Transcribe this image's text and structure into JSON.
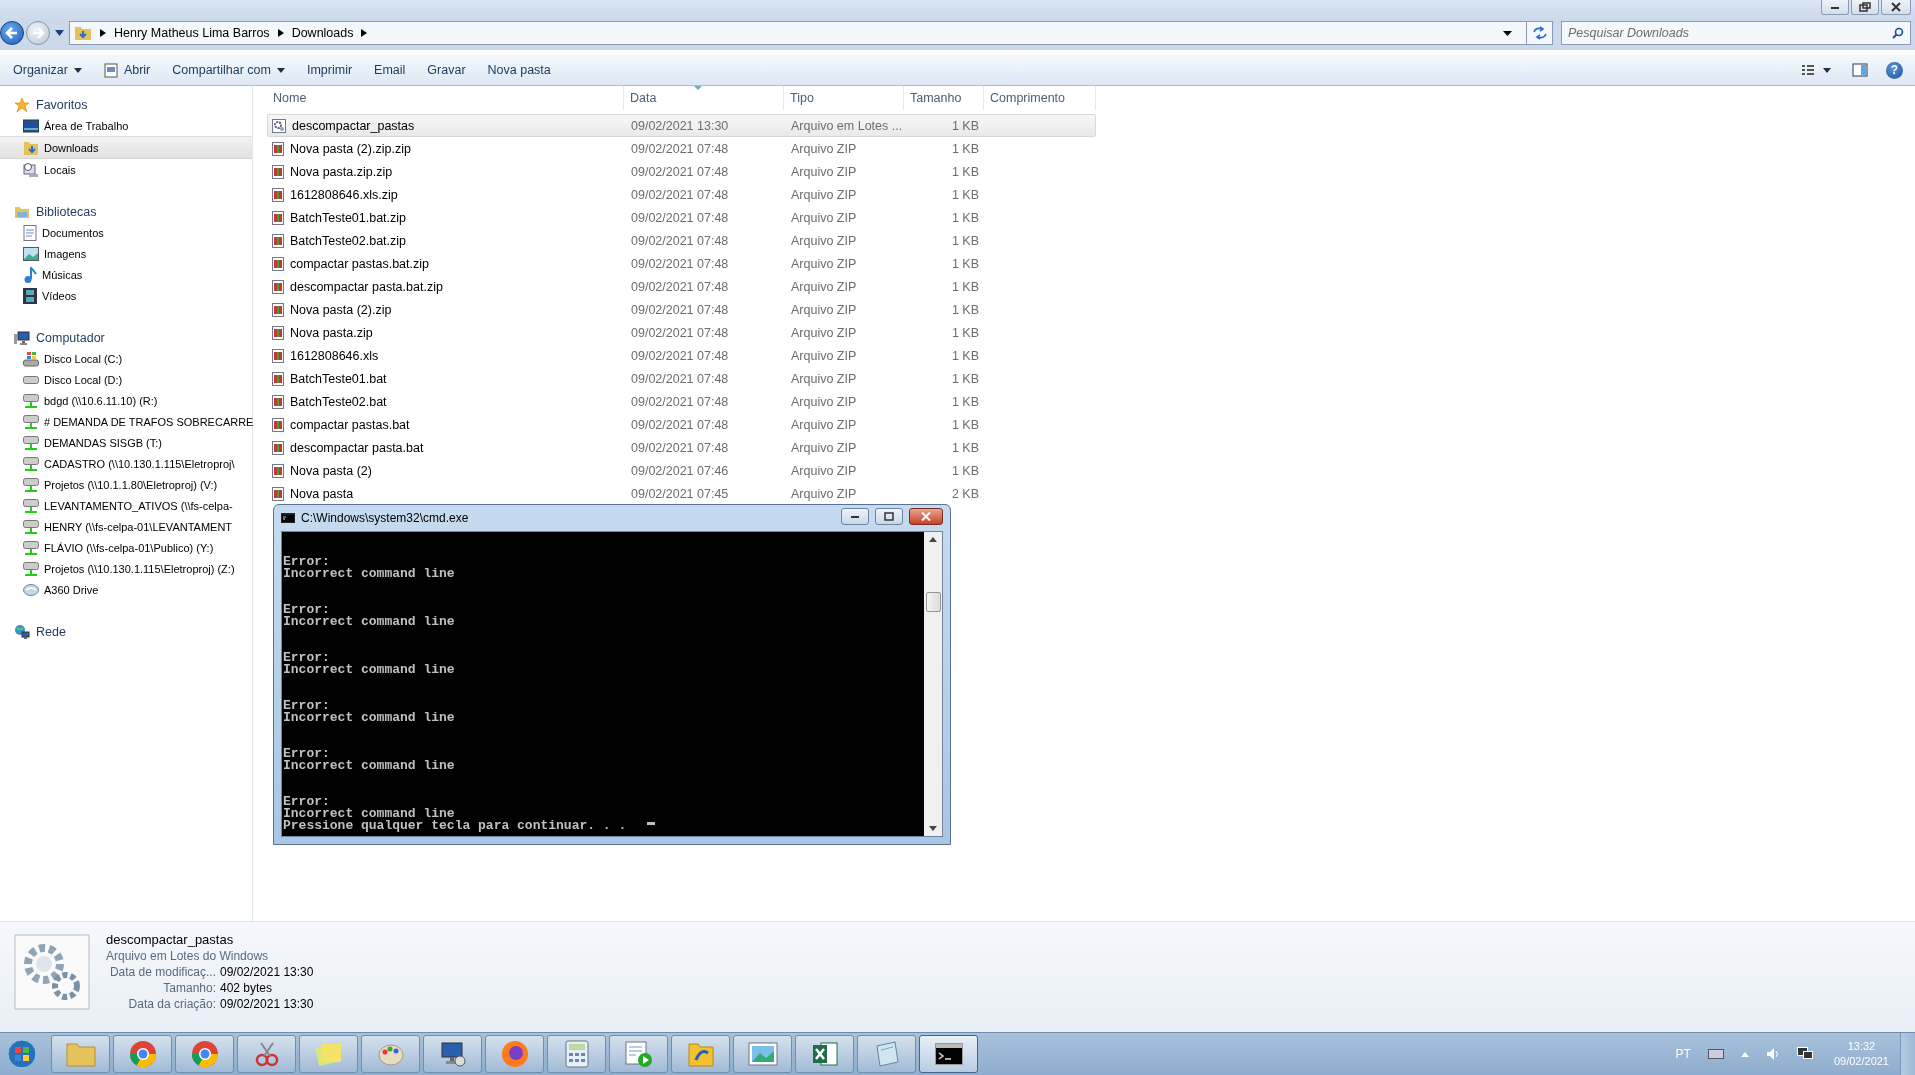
{
  "address": {
    "crumbs": [
      "Henry Matheus Lima Barros",
      "Downloads"
    ]
  },
  "search": {
    "placeholder": "Pesquisar Downloads"
  },
  "toolbar": [
    {
      "label": "Organizar",
      "kind": "menu"
    },
    {
      "label": "Abrir",
      "kind": "icon"
    },
    {
      "label": "Compartilhar com",
      "kind": "menu"
    },
    {
      "label": "Imprimir",
      "kind": "plain"
    },
    {
      "label": "Email",
      "kind": "plain"
    },
    {
      "label": "Gravar",
      "kind": "plain"
    },
    {
      "label": "Nova pasta",
      "kind": "plain"
    }
  ],
  "sidebar": {
    "groups": [
      {
        "label": "Favoritos",
        "kind": "star",
        "children": [
          {
            "label": "Área de Trabalho",
            "kind": "desktop",
            "selected": false
          },
          {
            "label": "Downloads",
            "kind": "downloads",
            "selected": true
          },
          {
            "label": "Locais",
            "kind": "recent",
            "selected": false
          }
        ]
      },
      {
        "label": "Bibliotecas",
        "kind": "library",
        "children": [
          {
            "label": "Documentos",
            "kind": "docs",
            "selected": false
          },
          {
            "label": "Imagens",
            "kind": "images",
            "selected": false
          },
          {
            "label": "Músicas",
            "kind": "music",
            "selected": false
          },
          {
            "label": "Vídeos",
            "kind": "video",
            "selected": false
          }
        ]
      },
      {
        "label": "Computador",
        "kind": "computer",
        "children": [
          {
            "label": "Disco Local (C:)",
            "kind": "windrive",
            "selected": false
          },
          {
            "label": "Disco Local (D:)",
            "kind": "drive",
            "selected": false
          },
          {
            "label": "bdgd (\\\\10.6.11.10) (R:)",
            "kind": "netdrive",
            "selected": false
          },
          {
            "label": "# DEMANDA DE TRAFOS SOBRECARRE",
            "kind": "netdrive",
            "selected": false
          },
          {
            "label": "DEMANDAS SISGB (T:)",
            "kind": "netdrive",
            "selected": false
          },
          {
            "label": "CADASTRO (\\\\10.130.1.115\\Eletroproj\\",
            "kind": "netdrive",
            "selected": false
          },
          {
            "label": "Projetos (\\\\10.1.1.80\\Eletroproj) (V:)",
            "kind": "netdrive",
            "selected": false
          },
          {
            "label": "LEVANTAMENTO_ATIVOS (\\\\fs-celpa-",
            "kind": "netdrive",
            "selected": false
          },
          {
            "label": "HENRY (\\\\fs-celpa-01\\LEVANTAMENT",
            "kind": "netdrive",
            "selected": false
          },
          {
            "label": "FLÁVIO (\\\\fs-celpa-01\\Publico) (Y:)",
            "kind": "netdrive",
            "selected": false
          },
          {
            "label": "Projetos (\\\\10.130.1.115\\Eletroproj) (Z:)",
            "kind": "netdrive",
            "selected": false
          },
          {
            "label": "A360 Drive",
            "kind": "cloud",
            "selected": false
          }
        ]
      },
      {
        "label": "Rede",
        "kind": "network"
      }
    ]
  },
  "help": {
    "label": "?"
  },
  "columns": [
    {
      "label": "Nome",
      "sorted": false
    },
    {
      "label": "Data",
      "sorted": true
    },
    {
      "label": "Tipo",
      "sorted": false
    },
    {
      "label": "Tamanho",
      "sorted": false
    },
    {
      "label": "Comprimento",
      "sorted": false
    }
  ],
  "files": [
    {
      "name": "descompactar_pastas",
      "date": "09/02/2021 13:30",
      "type": "Arquivo em Lotes ...",
      "size": "1 KB",
      "kind": "batch",
      "selected": true
    },
    {
      "name": "Nova pasta (2).zip.zip",
      "date": "09/02/2021 07:48",
      "type": "Arquivo ZIP",
      "size": "1 KB",
      "kind": "zip",
      "selected": false
    },
    {
      "name": "Nova pasta.zip.zip",
      "date": "09/02/2021 07:48",
      "type": "Arquivo ZIP",
      "size": "1 KB",
      "kind": "zip",
      "selected": false
    },
    {
      "name": "1612808646.xls.zip",
      "date": "09/02/2021 07:48",
      "type": "Arquivo ZIP",
      "size": "1 KB",
      "kind": "zip",
      "selected": false
    },
    {
      "name": "BatchTeste01.bat.zip",
      "date": "09/02/2021 07:48",
      "type": "Arquivo ZIP",
      "size": "1 KB",
      "kind": "zip",
      "selected": false
    },
    {
      "name": "BatchTeste02.bat.zip",
      "date": "09/02/2021 07:48",
      "type": "Arquivo ZIP",
      "size": "1 KB",
      "kind": "zip",
      "selected": false
    },
    {
      "name": "compactar pastas.bat.zip",
      "date": "09/02/2021 07:48",
      "type": "Arquivo ZIP",
      "size": "1 KB",
      "kind": "zip",
      "selected": false
    },
    {
      "name": "descompactar pasta.bat.zip",
      "date": "09/02/2021 07:48",
      "type": "Arquivo ZIP",
      "size": "1 KB",
      "kind": "zip",
      "selected": false
    },
    {
      "name": "Nova pasta (2).zip",
      "date": "09/02/2021 07:48",
      "type": "Arquivo ZIP",
      "size": "1 KB",
      "kind": "zip",
      "selected": false
    },
    {
      "name": "Nova pasta.zip",
      "date": "09/02/2021 07:48",
      "type": "Arquivo ZIP",
      "size": "1 KB",
      "kind": "zip",
      "selected": false
    },
    {
      "name": "1612808646.xls",
      "date": "09/02/2021 07:48",
      "type": "Arquivo ZIP",
      "size": "1 KB",
      "kind": "zip",
      "selected": false
    },
    {
      "name": "BatchTeste01.bat",
      "date": "09/02/2021 07:48",
      "type": "Arquivo ZIP",
      "size": "1 KB",
      "kind": "zip",
      "selected": false
    },
    {
      "name": "BatchTeste02.bat",
      "date": "09/02/2021 07:48",
      "type": "Arquivo ZIP",
      "size": "1 KB",
      "kind": "zip",
      "selected": false
    },
    {
      "name": "compactar pastas.bat",
      "date": "09/02/2021 07:48",
      "type": "Arquivo ZIP",
      "size": "1 KB",
      "kind": "zip",
      "selected": false
    },
    {
      "name": "descompactar pasta.bat",
      "date": "09/02/2021 07:48",
      "type": "Arquivo ZIP",
      "size": "1 KB",
      "kind": "zip",
      "selected": false
    },
    {
      "name": "Nova pasta (2)",
      "date": "09/02/2021 07:46",
      "type": "Arquivo ZIP",
      "size": "1 KB",
      "kind": "zip",
      "selected": false
    },
    {
      "name": "Nova pasta",
      "date": "09/02/2021 07:45",
      "type": "Arquivo ZIP",
      "size": "2 KB",
      "kind": "zip",
      "selected": false
    }
  ],
  "console": {
    "title": "C:\\Windows\\system32\\cmd.exe",
    "blocks": [
      [
        "Error:",
        "Incorrect command line"
      ],
      [
        "Error:",
        "Incorrect command line"
      ],
      [
        "Error:",
        "Incorrect command line"
      ],
      [
        "Error:",
        "Incorrect command line"
      ],
      [
        "Error:",
        "Incorrect command line"
      ],
      [
        "Error:",
        "Incorrect command line",
        "Pressione qualquer tecla para continuar. . ."
      ]
    ]
  },
  "details": {
    "name": "descompactar_pastas",
    "type": "Arquivo em Lotes do Windows",
    "fields": [
      {
        "label": "Data de modificaç...",
        "value": "09/02/2021 13:30"
      },
      {
        "label": "Tamanho:",
        "value": "402 bytes"
      },
      {
        "label": "Data da criação:",
        "value": "09/02/2021 13:30"
      }
    ]
  },
  "taskbar": [
    {
      "kind": "folder",
      "selected": false
    },
    {
      "kind": "chrome",
      "selected": false
    },
    {
      "kind": "chrome",
      "selected": false
    },
    {
      "kind": "scissors",
      "selected": false
    },
    {
      "kind": "notes",
      "selected": false
    },
    {
      "kind": "paint",
      "selected": false
    },
    {
      "kind": "monitor",
      "selected": false
    },
    {
      "kind": "firefox",
      "selected": false
    },
    {
      "kind": "calculator",
      "selected": false
    },
    {
      "kind": "media",
      "selected": false
    },
    {
      "kind": "sync",
      "selected": false
    },
    {
      "kind": "photo",
      "selected": false
    },
    {
      "kind": "excel",
      "selected": false
    },
    {
      "kind": "notepad",
      "selected": false
    },
    {
      "kind": "console",
      "selected": true
    }
  ],
  "tray": {
    "language": "PT",
    "time": "13:32",
    "date": "09/02/2021"
  }
}
